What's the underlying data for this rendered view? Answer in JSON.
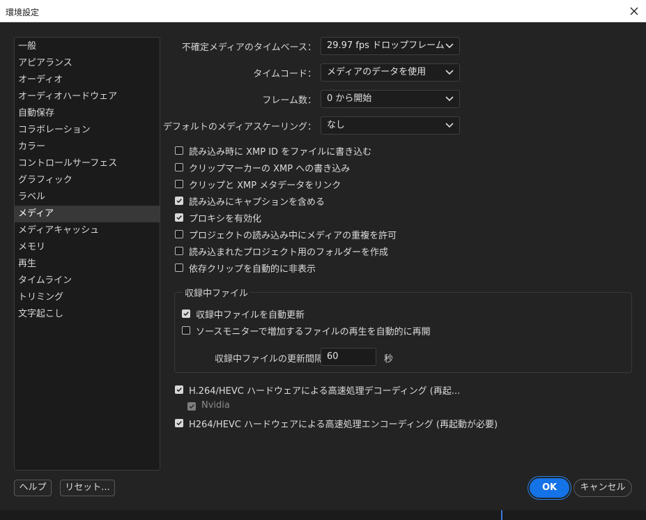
{
  "window": {
    "title": "環境設定"
  },
  "sidebar": {
    "items": [
      {
        "label": "一般",
        "selected": false
      },
      {
        "label": "アピアランス",
        "selected": false
      },
      {
        "label": "オーディオ",
        "selected": false
      },
      {
        "label": "オーディオハードウェア",
        "selected": false
      },
      {
        "label": "自動保存",
        "selected": false
      },
      {
        "label": "コラボレーション",
        "selected": false
      },
      {
        "label": "カラー",
        "selected": false
      },
      {
        "label": "コントロールサーフェス",
        "selected": false
      },
      {
        "label": "グラフィック",
        "selected": false
      },
      {
        "label": "ラベル",
        "selected": false
      },
      {
        "label": "メディア",
        "selected": true
      },
      {
        "label": "メディアキャッシュ",
        "selected": false
      },
      {
        "label": "メモリ",
        "selected": false
      },
      {
        "label": "再生",
        "selected": false
      },
      {
        "label": "タイムライン",
        "selected": false
      },
      {
        "label": "トリミング",
        "selected": false
      },
      {
        "label": "文字起こし",
        "selected": false
      }
    ]
  },
  "media": {
    "fields": [
      {
        "label": "不確定メディアのタイムベース：",
        "value": "29.97 fps ドロップフレーム"
      },
      {
        "label": "タイムコード：",
        "value": "メディアのデータを使用"
      },
      {
        "label": "フレーム数：",
        "value": "0 から開始"
      },
      {
        "label": "デフォルトのメディアスケーリング：",
        "value": "なし"
      }
    ],
    "checkboxes": [
      {
        "label": "読み込み時に XMP ID をファイルに書き込む",
        "checked": false
      },
      {
        "label": "クリップマーカーの XMP への書き込み",
        "checked": false
      },
      {
        "label": "クリップと XMP メタデータをリンク",
        "checked": false
      },
      {
        "label": "読み込みにキャプションを含める",
        "checked": true
      },
      {
        "label": "プロキシを有効化",
        "checked": true
      },
      {
        "label": "プロジェクトの読み込み中にメディアの重複を許可",
        "checked": false
      },
      {
        "label": "読み込まれたプロジェクト用のフォルダーを作成",
        "checked": false
      },
      {
        "label": "依存クリップを自動的に非表示",
        "checked": false
      }
    ],
    "growing_files": {
      "title": "収録中ファイル",
      "auto_refresh": {
        "label": "収録中ファイルを自動更新",
        "checked": true
      },
      "resume_playback": {
        "label": "ソースモニターで増加するファイルの再生を自動的に再開",
        "checked": false
      },
      "interval_label": "収録中ファイルの更新間隔",
      "interval_value": "60",
      "interval_unit": "秒"
    },
    "hw_decoding": {
      "label": "H.264/HEVC ハードウェアによる高速処理デコーディング (再起...",
      "checked": true
    },
    "nvidia": {
      "label": "Nvidia",
      "checked": true,
      "disabled": true
    },
    "hw_encoding": {
      "label": "H264/HEVC ハードウェアによる高速処理エンコーディング (再起動が必要)",
      "checked": true
    }
  },
  "footer": {
    "help_label": "ヘルプ",
    "reset_label": "リセット...",
    "ok_label": "OK",
    "cancel_label": "キャンセル"
  },
  "colors": {
    "accent": "#1473e6",
    "background": "#232323",
    "panel": "#1b1b1b"
  }
}
